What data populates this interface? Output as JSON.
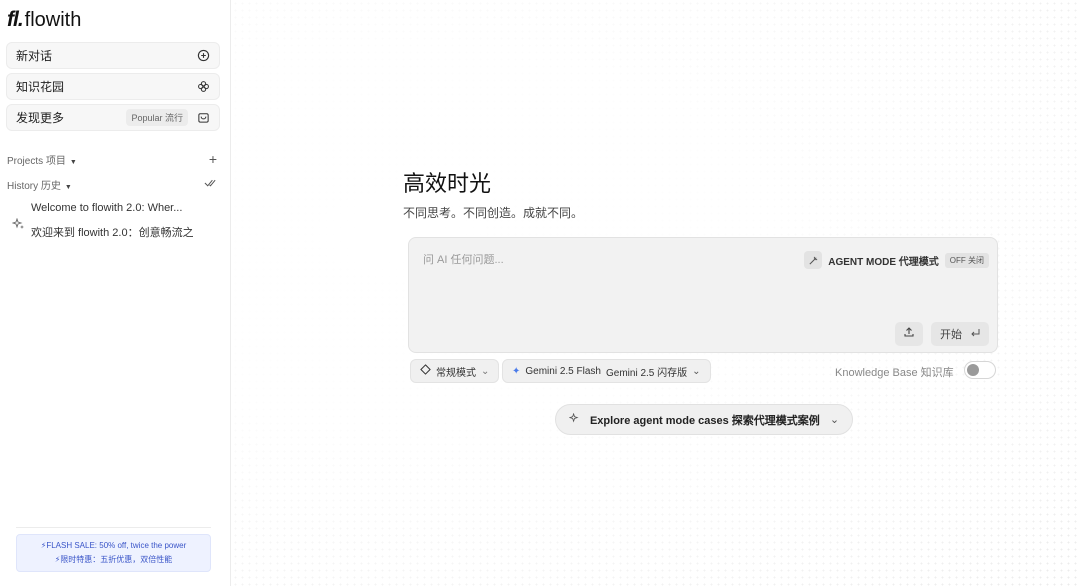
{
  "brand": {
    "mark": "fl.",
    "name": "flowith"
  },
  "sidebar": {
    "new_chat": "新对话",
    "knowledge_garden": "知识花园",
    "discover": "发现更多",
    "discover_badge": "Popular 流行",
    "projects_label": "Projects 项目",
    "history_label": "History 历史",
    "history_items": [
      {
        "line1": "Welcome to flowith 2.0: Wher...",
        "line2": "欢迎来到 flowith 2.0：创意畅流之"
      }
    ]
  },
  "sale": {
    "line1": "⚡FLASH SALE: 50% off, twice the power",
    "line2": "⚡限时特惠：五折优惠，双倍性能"
  },
  "hero": {
    "title": "高效时光",
    "subtitle": "不同思考。不同创造。成就不同。"
  },
  "composer": {
    "placeholder": "问 AI 任何问题...",
    "agent_mode_label": "AGENT MODE 代理模式",
    "agent_mode_state": "OFF 关闭",
    "start_label": "开始"
  },
  "options": {
    "mode_label": "常规模式",
    "model_label": "Gemini 2.5 Flash",
    "model_sublabel": "Gemini 2.5 闪存版",
    "kb_label": "Knowledge Base 知识库",
    "kb_enabled": false
  },
  "explore_label": "Explore agent mode cases 探索代理模式案例"
}
